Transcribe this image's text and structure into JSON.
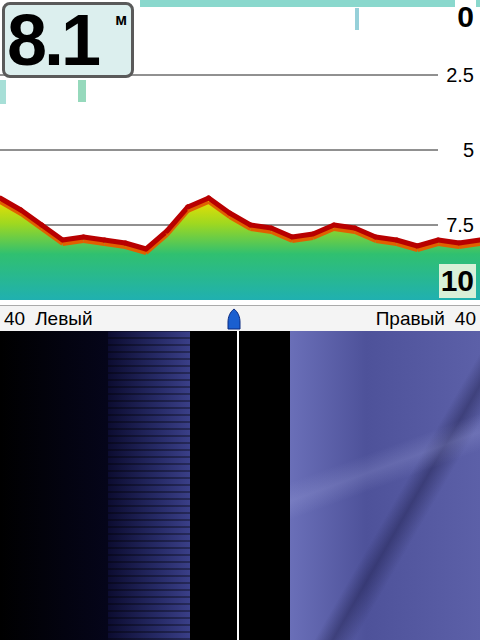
{
  "depth": {
    "value": "8.1",
    "unit": "м"
  },
  "scale": {
    "ticks": [
      "0",
      "2.5",
      "5",
      "7.5",
      "10"
    ]
  },
  "bottom_profile": {
    "unit": "m",
    "values": [
      6.6,
      7.0,
      7.5,
      8.0,
      7.9,
      8.0,
      8.1,
      8.3,
      7.7,
      6.9,
      6.6,
      7.1,
      7.5,
      7.6,
      7.9,
      7.8,
      7.5,
      7.6,
      7.9,
      8.0,
      8.2,
      8.0,
      8.1,
      8.0
    ]
  },
  "side_scan": {
    "left": {
      "range": "40",
      "label": "Левый"
    },
    "right": {
      "label": "Правый",
      "range": "40"
    }
  }
}
